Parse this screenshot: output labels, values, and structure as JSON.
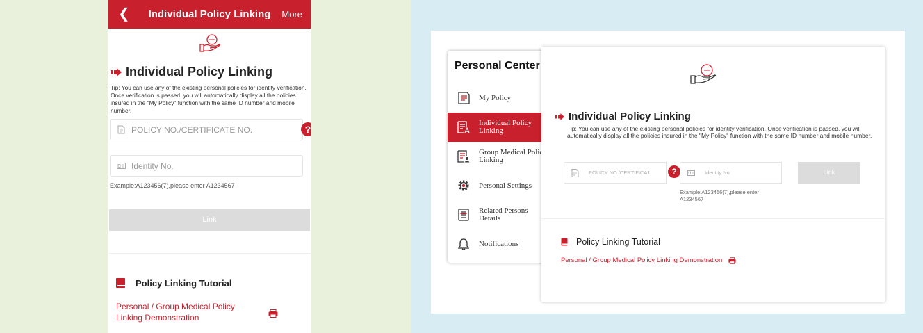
{
  "mobile": {
    "header": {
      "back_icon": "chevron-left-icon",
      "title": "Individual Policy Linking",
      "more_label": "More"
    },
    "heading": "Individual Policy Linking",
    "tip": "Tip: You can use any of the existing personal policies for identity verification. Once verification is passed, you will automatically display all the policies insured in the \"My Policy\" function with the same ID number and mobile number.",
    "policy_placeholder": "POLICY NO./CERTIFICATE NO.",
    "identity_placeholder": "Identity No.",
    "help_glyph": "?",
    "example": "Example:A123456(7),please enter A1234567",
    "link_button": "Link",
    "tutorial_title": "Policy Linking Tutorial",
    "demo_link": "Personal / Group Medical Policy Linking Demonstration"
  },
  "desktop": {
    "sidebar": {
      "title": "Personal Center",
      "items": [
        {
          "label": "My Policy",
          "icon": "document-icon"
        },
        {
          "label": "Individual Policy Linking",
          "icon": "policy-link-icon",
          "active": true
        },
        {
          "label": "Group Medical Policy Linking",
          "icon": "group-policy-icon"
        },
        {
          "label": "Personal Settings",
          "icon": "gear-icon"
        },
        {
          "label": "Related Persons Details",
          "icon": "persons-list-icon"
        },
        {
          "label": "Notifications",
          "icon": "bell-icon"
        }
      ]
    },
    "heading": "Individual Policy Linking",
    "tip": "Tip: You can use any of the existing personal policies for identity verification. Once verification is passed, you will automatically display all the policies insured in the \"My Policy\" function with the same ID number and mobile number.",
    "policy_placeholder": "POLICY NO./CERTIFICA1",
    "identity_placeholder": "Identity No",
    "help_glyph": "?",
    "example": "Example:A123456(7),please enter A1234567",
    "link_button": "Link",
    "tutorial_title": "Policy Linking Tutorial",
    "demo_link": "Personal / Group Medical Policy Linking Demonstration"
  },
  "colors": {
    "brand_red": "#c8202d",
    "left_background": "#e9f1dd",
    "right_background": "#d8ecf3",
    "disabled_button": "#dcdcdc"
  }
}
